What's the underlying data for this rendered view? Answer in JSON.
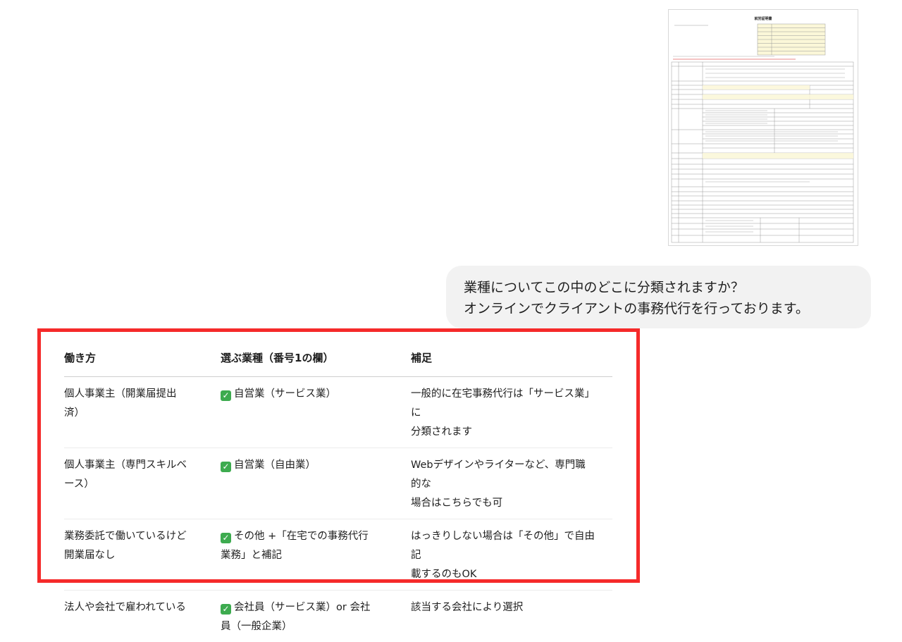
{
  "attachment": {
    "title": "就労証明書",
    "icon": "document-thumbnail"
  },
  "message": {
    "lines": [
      "業種についてこの中のどこに分類されますか？",
      "オンラインでクライアントの事務代行を行っております。"
    ]
  },
  "table": {
    "headers": [
      "働き方",
      "選ぶ業種（番号1の欄）",
      "補足"
    ],
    "rows": [
      {
        "style": [
          "個人事業主（開業届提出",
          "済）"
        ],
        "industry": [
          "自営業（サービス業）"
        ],
        "note": [
          "一般的に在宅事務代行は「サービス業」に",
          "分類されます"
        ]
      },
      {
        "style": [
          "個人事業主（専門スキルベ",
          "ース）"
        ],
        "industry": [
          "自営業（自由業）"
        ],
        "note": [
          "Webデザインやライターなど、専門職的な",
          "場合はこちらでも可"
        ]
      },
      {
        "style": [
          "業務委託で働いているけど",
          "開業届なし"
        ],
        "industry": [
          "その他 +「在宅での事務代行",
          "業務」と補記"
        ],
        "note": [
          "はっきりしない場合は「その他」で自由記",
          "載するのもOK"
        ]
      },
      {
        "style": [
          "法人や会社で雇われている"
        ],
        "industry": [
          "会社員（サービス業）or 会社",
          "員（一般企業）"
        ],
        "note": [
          "該当する会社により選択"
        ]
      }
    ],
    "check_icon": "check-mark-button-icon"
  },
  "colors": {
    "highlight_border": "#f52a2a",
    "bubble_bg": "#f2f2f2",
    "check_green": "#3dab4f"
  }
}
